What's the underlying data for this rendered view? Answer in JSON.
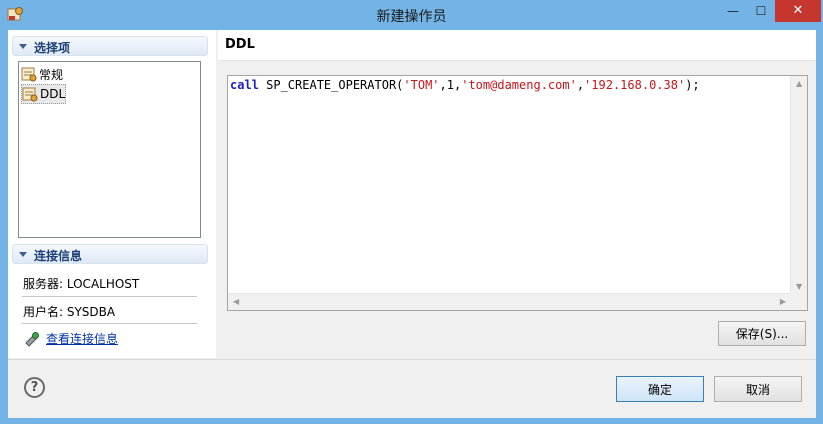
{
  "window": {
    "title": "新建操作员",
    "min_label": "—",
    "max_label": "☐",
    "close_label": "✕"
  },
  "left": {
    "options_header": "选择项",
    "tree_items": [
      {
        "label": "常规",
        "icon": "page-icon"
      },
      {
        "label": "DDL",
        "icon": "page-icon",
        "selected": true
      }
    ],
    "conn_header": "连接信息",
    "server_line": "服务器: LOCALHOST",
    "user_line": "用户名: SYSDBA",
    "view_link": "查看连接信息"
  },
  "right": {
    "title": "DDL",
    "code": {
      "kw": "call",
      "proc": " SP_CREATE_OPERATOR(",
      "s1": "'TOM'",
      "c1": ",1,",
      "s2": "'tom@dameng.com'",
      "c2": ",",
      "s3": "'192.168.0.38'",
      "end": ");"
    },
    "save_button": "保存(S)..."
  },
  "footer": {
    "help": "?",
    "ok_button": "确定",
    "cancel_button": "取消"
  }
}
